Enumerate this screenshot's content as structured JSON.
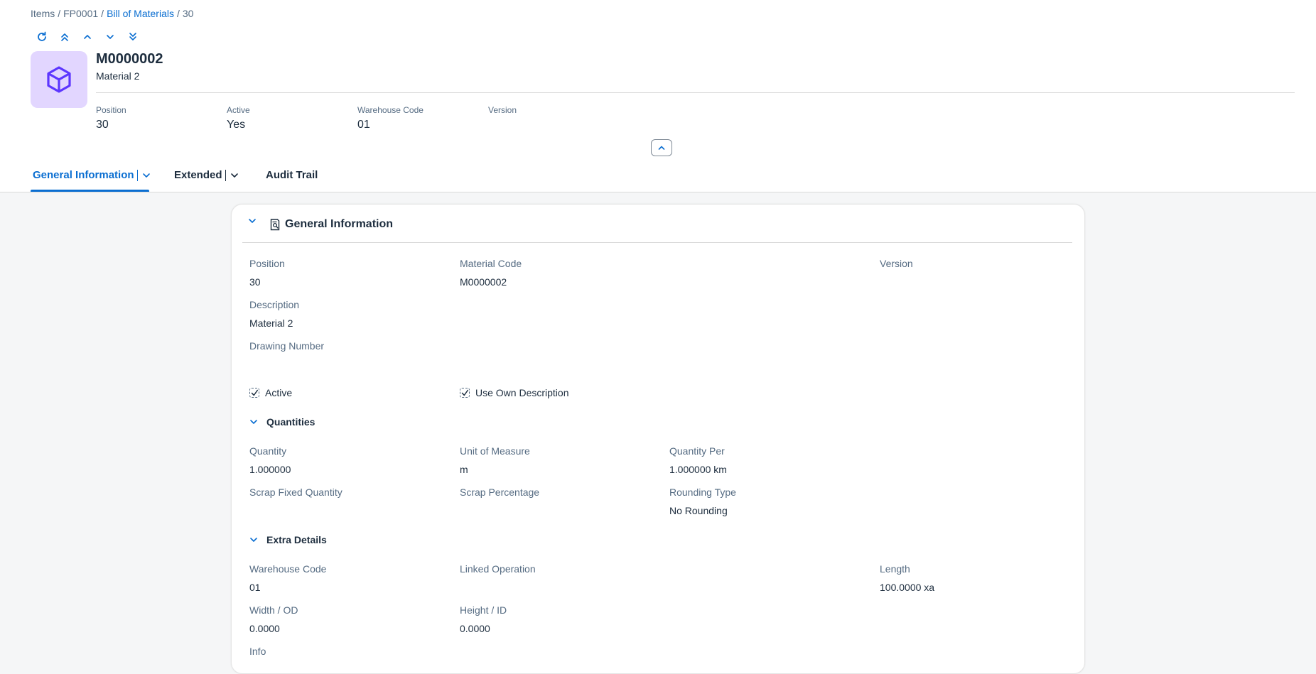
{
  "breadcrumb": {
    "items": [
      "Items",
      "FP0001",
      "Bill of Materials",
      "30"
    ],
    "separator": "/"
  },
  "header": {
    "title": "M0000002",
    "subtitle": "Material 2",
    "avatar_icon": "cube-icon",
    "kpis": [
      {
        "label": "Position",
        "value": "30"
      },
      {
        "label": "Active",
        "value": "Yes"
      },
      {
        "label": "Warehouse Code",
        "value": "01"
      },
      {
        "label": "Version",
        "value": ""
      }
    ]
  },
  "tabs": [
    {
      "label": "General Information",
      "active": true
    },
    {
      "label": "Extended",
      "active": false
    },
    {
      "label": "Audit Trail",
      "active": false
    }
  ],
  "section": {
    "title": "General Information",
    "icon": "document-icon",
    "fields": {
      "position": {
        "label": "Position",
        "value": "30"
      },
      "material_code": {
        "label": "Material Code",
        "value": "M0000002"
      },
      "version": {
        "label": "Version",
        "value": ""
      },
      "description": {
        "label": "Description",
        "value": "Material 2"
      },
      "drawing_number": {
        "label": "Drawing Number",
        "value": ""
      }
    },
    "checkboxes": {
      "active": {
        "label": "Active",
        "checked": true
      },
      "use_own_description": {
        "label": "Use Own Description",
        "checked": true
      }
    }
  },
  "quantities": {
    "title": "Quantities",
    "quantity": {
      "label": "Quantity",
      "value": "1.000000"
    },
    "uom": {
      "label": "Unit of Measure",
      "value": "m"
    },
    "quantity_per": {
      "label": "Quantity Per",
      "value": "1.000000 km"
    },
    "scrap_fixed": {
      "label": "Scrap Fixed Quantity",
      "value": ""
    },
    "scrap_pct": {
      "label": "Scrap Percentage",
      "value": ""
    },
    "rounding": {
      "label": "Rounding Type",
      "value": "No Rounding"
    }
  },
  "extra": {
    "title": "Extra Details",
    "warehouse": {
      "label": "Warehouse Code",
      "value": "01"
    },
    "linked_op": {
      "label": "Linked Operation",
      "value": ""
    },
    "length": {
      "label": "Length",
      "value": "100.0000 xa"
    },
    "width": {
      "label": "Width / OD",
      "value": "0.0000"
    },
    "height": {
      "label": "Height / ID",
      "value": "0.0000"
    },
    "info": {
      "label": "Info"
    }
  },
  "colors": {
    "accent": "#0a6ed1",
    "avatar_bg": "#e2d6ff",
    "avatar_icon": "#5d36ff"
  }
}
